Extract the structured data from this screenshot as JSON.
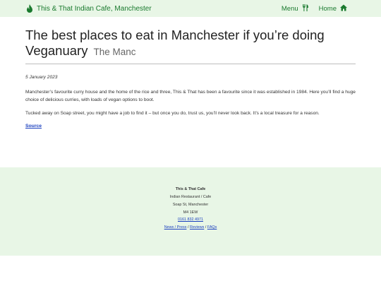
{
  "header": {
    "brand_label": "This & That Indian Cafe, Manchester",
    "menu_label": "Menu",
    "home_label": "Home"
  },
  "article": {
    "title": "The best places to eat in Manchester if you’re doing Veganuary",
    "source_name": "The Manc",
    "date": "5 January 2023",
    "paragraph1": "Manchester’s favourite curry house and the home of the rice and three, This & That has been a favourite since it was established in 1984. Here you’ll find a huge choice of delicious curries, with loads of vegan options to boot.",
    "paragraph2": "Tucked away on Soap street, you might have a job to find it – but once you do, trust us, you’ll never look back. It’s a local treasure for a reason.",
    "source_link": "Source"
  },
  "footer": {
    "name": "This & That Cafe",
    "type": "Indian Restaurant / Cafe",
    "street": "Soap St, Manchester",
    "postcode": "M4 1EW",
    "phone": "0161 832 4971",
    "links": [
      "News / Press",
      "Reviews",
      "FAQs"
    ],
    "separator": " / "
  },
  "colors": {
    "accent": "#1a7a2e",
    "band": "#e8f6e6",
    "link": "#1a3fbf"
  },
  "icons": {
    "brand": "flame-icon",
    "menu": "cutlery-icon",
    "home": "home-icon"
  }
}
